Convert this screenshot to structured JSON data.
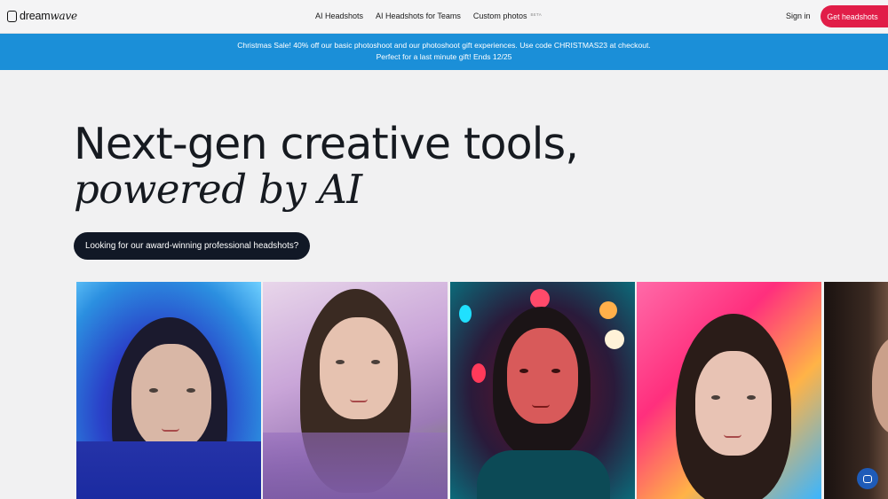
{
  "brand": {
    "name_plain": "dream",
    "name_italic": "wave"
  },
  "nav": {
    "links": [
      "AI Headshots",
      "AI Headshots for Teams",
      "Custom photos"
    ],
    "beta_badge": "BETA",
    "signin": "Sign in",
    "cta": "Get headshots"
  },
  "banner": {
    "line1": "Christmas Sale! 40% off our basic photoshoot and our photoshoot gift experiences. Use code CHRISTMAS23 at checkout.",
    "line2": "Perfect for a last minute gift! Ends 12/25"
  },
  "hero": {
    "title_line1": "Next-gen creative tools,",
    "title_line2": "powered by AI",
    "pill": "Looking for our award-winning professional headshots?"
  },
  "icons": {
    "chat": "chat-bubble-icon",
    "logo": "square-logo-icon"
  },
  "colors": {
    "accent": "#e11d48",
    "banner": "#1b8fd8",
    "pill": "#111826"
  }
}
